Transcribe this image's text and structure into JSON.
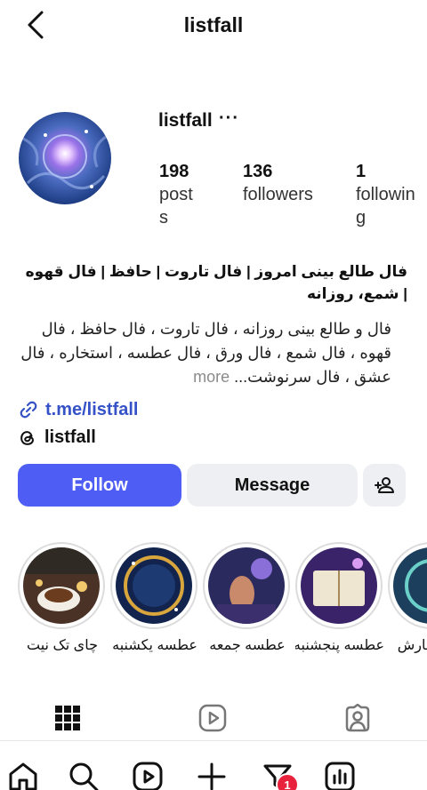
{
  "header": {
    "title": "listfall"
  },
  "profile": {
    "username": "listfall",
    "more": "···",
    "stats": [
      {
        "value": "198",
        "label": "posts"
      },
      {
        "value": "136",
        "label": "followers"
      },
      {
        "value": "1",
        "label": "following"
      }
    ],
    "bio_title": "فال طالع بینی امروز | فال تاروت | حافظ | فال قهوه | شمع، روزانه",
    "bio_text": "فال و طالع بینی روزانه ، فال تاروت ، فال حافظ ، فال قهوه ، فال شمع ، فال ورق ، فال عطسه ، استخاره ، فال عشق ، فال سرنوشت...",
    "bio_more": "more",
    "link": "t.me/listfall",
    "threads": "listfall"
  },
  "actions": {
    "follow": "Follow",
    "message": "Message"
  },
  "highlights": [
    {
      "label": "چای تک نیت"
    },
    {
      "label": "عطسه یکشنبه"
    },
    {
      "label": "عطسه جمعه"
    },
    {
      "label": "عطسه پنجشنبه"
    },
    {
      "label": "...استخارش"
    }
  ],
  "nav": {
    "badge": "1"
  },
  "colors": {
    "accent": "#4e5ef5",
    "link": "#3552c7",
    "badge": "#e8213c"
  }
}
